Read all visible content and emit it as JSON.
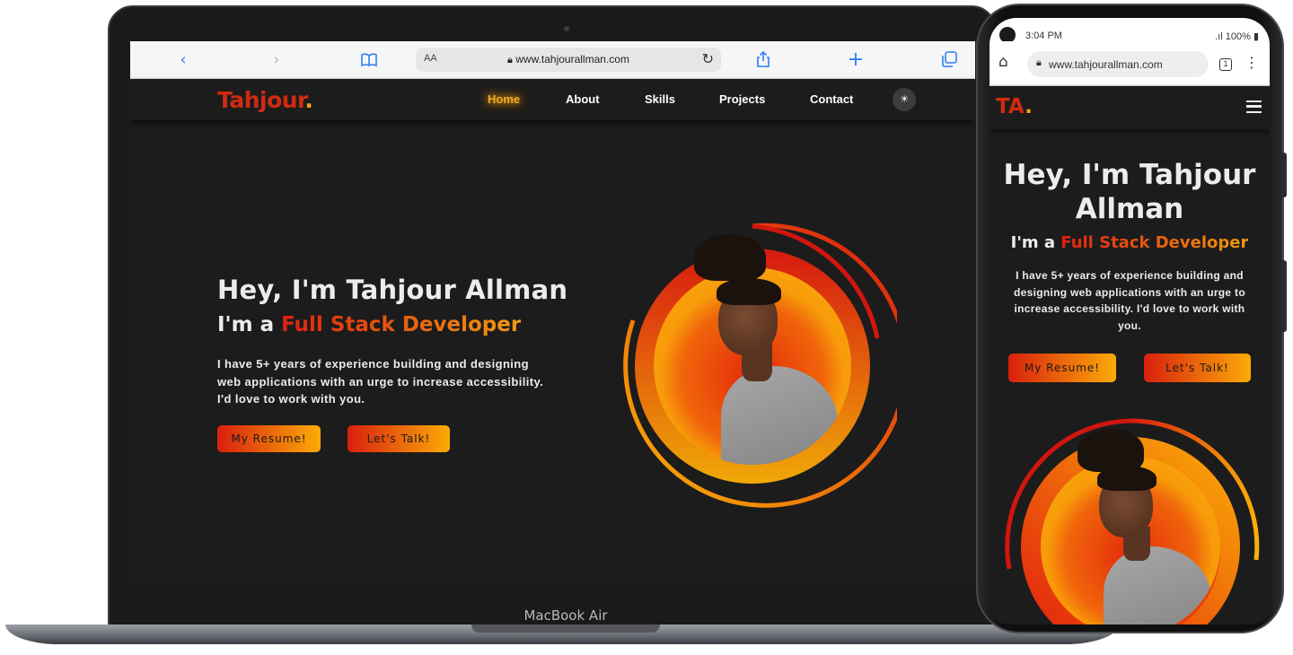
{
  "laptop": {
    "brand": "MacBook Air",
    "browser": {
      "text_size_label": "AA",
      "url": "www.tahjourallman.com"
    }
  },
  "site": {
    "logo_text": "Tahjour",
    "logo_dot": ".",
    "nav": [
      {
        "label": "Home",
        "active": true
      },
      {
        "label": "About",
        "active": false
      },
      {
        "label": "Skills",
        "active": false
      },
      {
        "label": "Projects",
        "active": false
      },
      {
        "label": "Contact",
        "active": false
      }
    ],
    "hero": {
      "greeting": "Hey, I'm Tahjour Allman",
      "role_prefix": "I'm a ",
      "role_highlight": "Full Stack Developer",
      "description": "I have 5+ years of experience building and designing web applications with an urge to increase accessibility. I'd love to work with you.",
      "resume_button": "My Resume!",
      "talk_button": "Let's Talk!"
    }
  },
  "phone": {
    "status": {
      "time": "3:04 PM",
      "battery": "100%"
    },
    "url": "www.tahjourallman.com",
    "tab_count": "1",
    "logo_text": "TA",
    "logo_dot": ".",
    "greeting": "Hey, I'm Tahjour Allman",
    "role_prefix": "I'm a ",
    "role_highlight": "Full Stack Developer",
    "description": "I have 5+ years of experience building and designing web applications with an urge to increase accessibility. I'd love to work with you.",
    "resume_button": "My Resume!",
    "talk_button": "Let's Talk!"
  },
  "colors": {
    "accent_red": "#d22a10",
    "accent_orange": "#f5a40b",
    "background": "#1c1c1c",
    "safari_blue": "#2f7ef6"
  }
}
